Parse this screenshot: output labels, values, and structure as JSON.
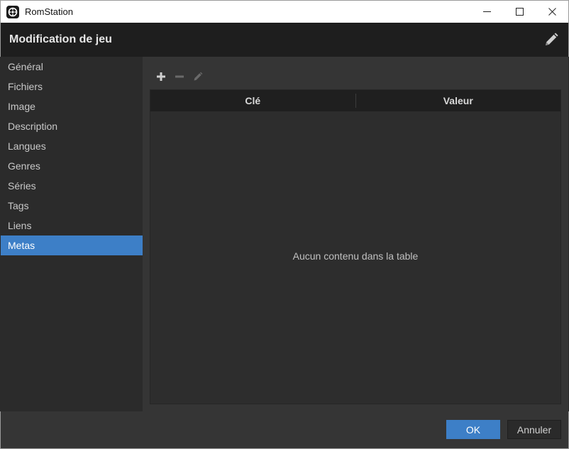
{
  "window": {
    "title": "RomStation",
    "controls": {
      "minimize": "—",
      "maximize": "☐",
      "close": "✕"
    }
  },
  "dialog": {
    "title": "Modification de jeu"
  },
  "sidebar": {
    "items": [
      {
        "label": "Général"
      },
      {
        "label": "Fichiers"
      },
      {
        "label": "Image"
      },
      {
        "label": "Description"
      },
      {
        "label": "Langues"
      },
      {
        "label": "Genres"
      },
      {
        "label": "Séries"
      },
      {
        "label": "Tags"
      },
      {
        "label": "Liens"
      },
      {
        "label": "Metas",
        "active": true
      }
    ]
  },
  "table": {
    "columns": [
      "Clé",
      "Valeur"
    ],
    "empty_message": "Aucun contenu dans la table"
  },
  "footer": {
    "ok_label": "OK",
    "cancel_label": "Annuler"
  },
  "colors": {
    "accent": "#3d7fc7",
    "header_bg": "#1e1e1e",
    "panel_bg": "#353535",
    "sidebar_bg": "#2b2b2b"
  }
}
